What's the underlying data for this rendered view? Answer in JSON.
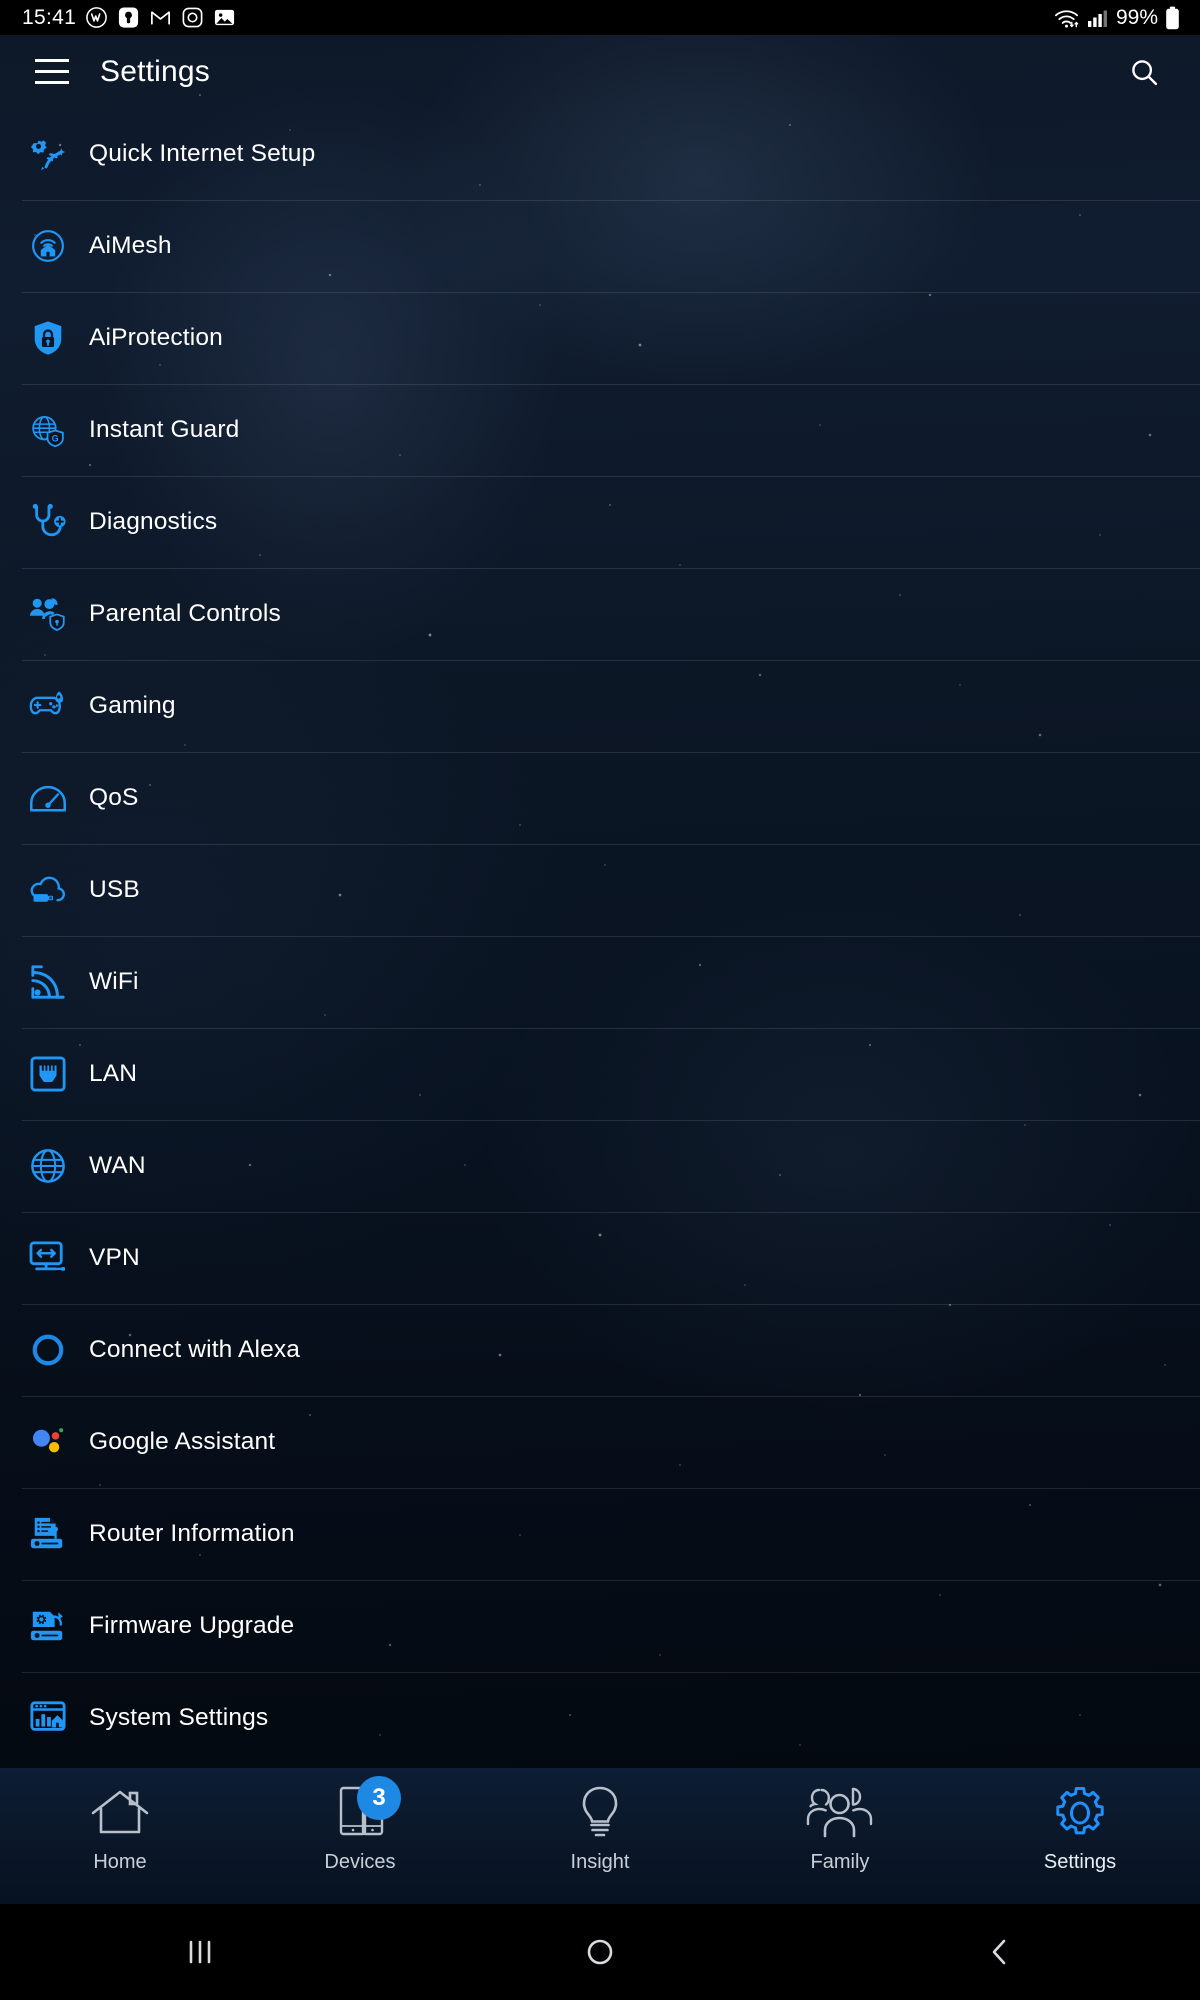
{
  "status_bar": {
    "time": "15:41",
    "left_icons": [
      "wordpress-icon",
      "notification-app-icon",
      "gmail-icon",
      "instagram-icon",
      "photos-icon"
    ],
    "right_icons": [
      "wifi-icon",
      "cellular-signal-icon"
    ],
    "battery_text": "99%",
    "battery_icon": "battery-full-icon"
  },
  "app_bar": {
    "menu_icon": "hamburger-menu-icon",
    "title": "Settings",
    "search_icon": "search-icon"
  },
  "settings_list": [
    {
      "label": "Quick Internet Setup",
      "icon": "quick-internet-setup-icon"
    },
    {
      "label": "AiMesh",
      "icon": "aimesh-icon"
    },
    {
      "label": "AiProtection",
      "icon": "aiprotection-shield-lock-icon"
    },
    {
      "label": "Instant Guard",
      "icon": "instant-guard-globe-icon"
    },
    {
      "label": "Diagnostics",
      "icon": "diagnostics-stethoscope-icon"
    },
    {
      "label": "Parental Controls",
      "icon": "parental-controls-icon"
    },
    {
      "label": "Gaming",
      "icon": "gaming-gamepad-icon"
    },
    {
      "label": "QoS",
      "icon": "qos-speedometer-icon"
    },
    {
      "label": "USB",
      "icon": "usb-cloud-icon"
    },
    {
      "label": "WiFi",
      "icon": "wifi-signal-icon"
    },
    {
      "label": "LAN",
      "icon": "lan-ethernet-port-icon"
    },
    {
      "label": "WAN",
      "icon": "wan-globe-icon"
    },
    {
      "label": "VPN",
      "icon": "vpn-monitor-icon"
    },
    {
      "label": "Connect with Alexa",
      "icon": "alexa-ring-icon"
    },
    {
      "label": "Google Assistant",
      "icon": "google-assistant-icon"
    },
    {
      "label": "Router Information",
      "icon": "router-information-icon"
    },
    {
      "label": "Firmware Upgrade",
      "icon": "firmware-upgrade-icon"
    },
    {
      "label": "System Settings",
      "icon": "system-settings-icon"
    }
  ],
  "bottom_nav": [
    {
      "label": "Home",
      "icon": "home-icon",
      "active": false,
      "badge": ""
    },
    {
      "label": "Devices",
      "icon": "devices-icon",
      "active": false,
      "badge": "3"
    },
    {
      "label": "Insight",
      "icon": "insight-bulb-icon",
      "active": false,
      "badge": ""
    },
    {
      "label": "Family",
      "icon": "family-people-icon",
      "active": false,
      "badge": ""
    },
    {
      "label": "Settings",
      "icon": "settings-gear-icon",
      "active": true,
      "badge": ""
    }
  ],
  "system_nav": {
    "recents_icon": "recents-icon",
    "home_icon": "home-circle-icon",
    "back_icon": "back-chevron-icon"
  },
  "colors": {
    "accent_blue": "#2196F3",
    "badge_blue": "#1E88E5",
    "text_white": "#FFFFFF",
    "nav_inactive": "#c9cfd8"
  }
}
